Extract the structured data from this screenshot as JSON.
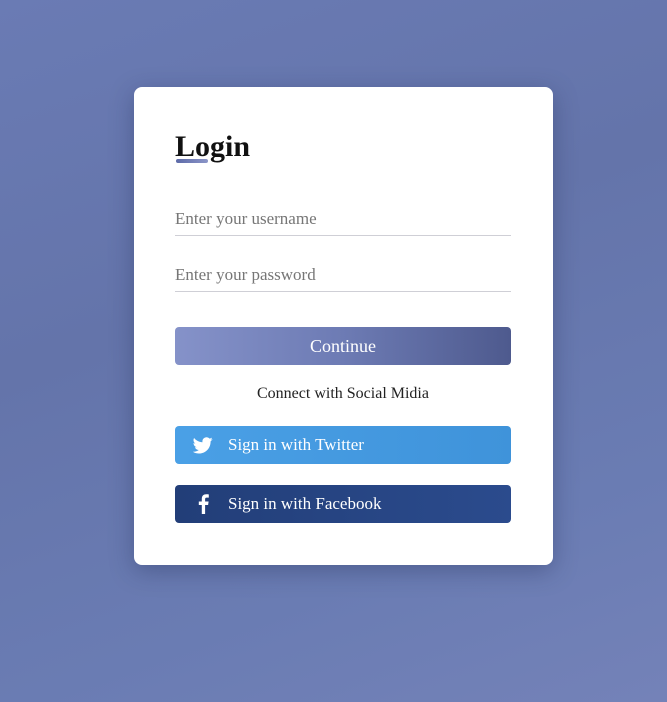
{
  "login_card": {
    "title": "Login",
    "username": {
      "placeholder": "Enter your username",
      "value": ""
    },
    "password": {
      "placeholder": "Enter your password",
      "value": ""
    },
    "continue_label": "Continue",
    "social_caption": "Connect with Social Midia",
    "twitter_label": "Sign in with Twitter",
    "facebook_label": "Sign in with Facebook"
  },
  "colors": {
    "background": "#6a7bb4",
    "card": "#ffffff",
    "continue_button": "#6d7bb4",
    "twitter": "#4aa0e6",
    "facebook": "#223e78"
  },
  "icons": {
    "twitter": "twitter-bird-icon",
    "facebook": "facebook-f-icon"
  }
}
